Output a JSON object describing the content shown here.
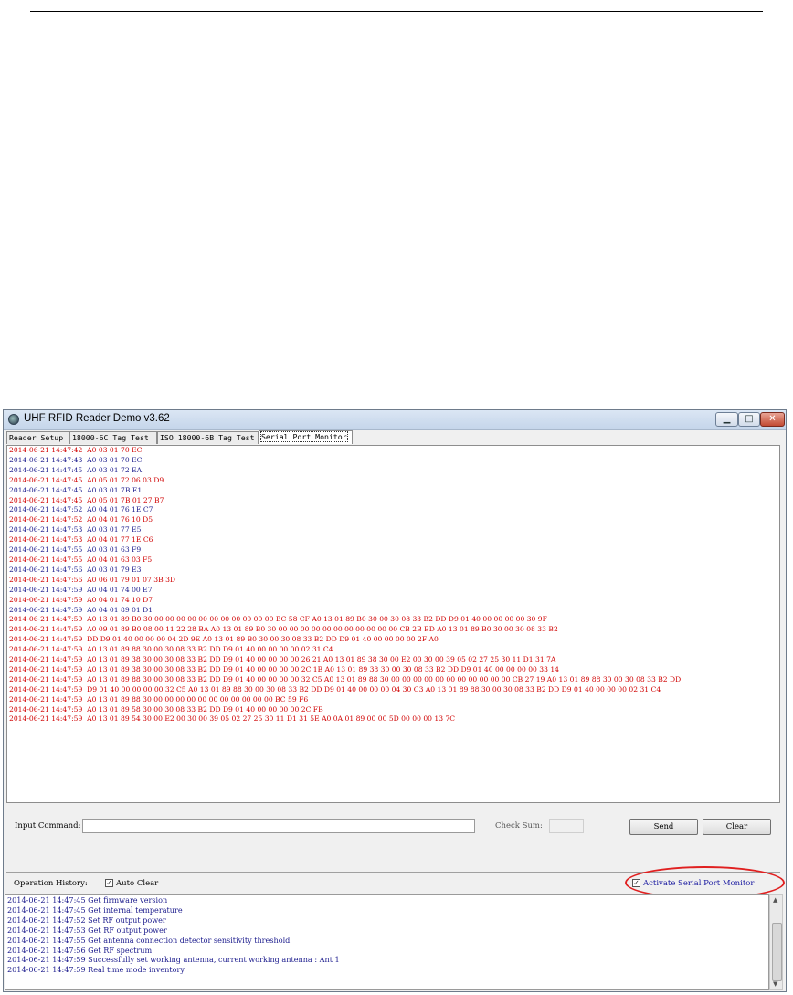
{
  "window": {
    "title": "UHF RFID Reader Demo v3.62"
  },
  "tabs": [
    {
      "label": "Reader Setup"
    },
    {
      "label": "18000-6C Tag Test"
    },
    {
      "label": "ISO 18000-6B Tag Test"
    },
    {
      "label": "Serial Port Monitor"
    }
  ],
  "monitor_lines": [
    {
      "text": "2014-06-21 14:47:42  A0 03 01 70 EC",
      "color": "#d00000"
    },
    {
      "text": "2014-06-21 14:47:43  A0 03 01 70 EC",
      "color": "#1a1a8c"
    },
    {
      "text": "2014-06-21 14:47:45  A0 03 01 72 EA",
      "color": "#1a1a8c"
    },
    {
      "text": "2014-06-21 14:47:45  A0 05 01 72 06 03 D9",
      "color": "#d00000"
    },
    {
      "text": "2014-06-21 14:47:45  A0 03 01 7B E1",
      "color": "#1a1a8c"
    },
    {
      "text": "2014-06-21 14:47:45  A0 05 01 7B 01 27 B7",
      "color": "#d00000"
    },
    {
      "text": "2014-06-21 14:47:52  A0 04 01 76 1E C7",
      "color": "#1a1a8c"
    },
    {
      "text": "2014-06-21 14:47:52  A0 04 01 76 10 D5",
      "color": "#d00000"
    },
    {
      "text": "2014-06-21 14:47:53  A0 03 01 77 E5",
      "color": "#1a1a8c"
    },
    {
      "text": "2014-06-21 14:47:53  A0 04 01 77 1E C6",
      "color": "#d00000"
    },
    {
      "text": "2014-06-21 14:47:55  A0 03 01 63 F9",
      "color": "#1a1a8c"
    },
    {
      "text": "2014-06-21 14:47:55  A0 04 01 63 03 F5",
      "color": "#d00000"
    },
    {
      "text": "2014-06-21 14:47:56  A0 03 01 79 E3",
      "color": "#1a1a8c"
    },
    {
      "text": "2014-06-21 14:47:56  A0 06 01 79 01 07 3B 3D",
      "color": "#d00000"
    },
    {
      "text": "2014-06-21 14:47:59  A0 04 01 74 00 E7",
      "color": "#1a1a8c"
    },
    {
      "text": "2014-06-21 14:47:59  A0 04 01 74 10 D7",
      "color": "#d00000"
    },
    {
      "text": "2014-06-21 14:47:59  A0 04 01 89 01 D1",
      "color": "#1a1a8c"
    },
    {
      "text": "2014-06-21 14:47:59  A0 13 01 89 B0 30 00 00 00 00 00 00 00 00 00 00 00 BC 58 CF A0 13 01 89 B0 30 00 30 08 33 B2 DD D9 01 40 00 00 00 00 30 9F",
      "color": "#d00000"
    },
    {
      "text": "2014-06-21 14:47:59  A0 09 01 89 B0 08 00 11 22 28 BA A0 13 01 89 B0 30 00 00 00 00 00 00 00 00 00 00 00 CB 2B BD A0 13 01 89 B0 30 00 30 08 33 B2",
      "color": "#d00000"
    },
    {
      "text": "2014-06-21 14:47:59  DD D9 01 40 00 00 00 04 2D 9E A0 13 01 89 B0 30 00 30 08 33 B2 DD D9 01 40 00 00 00 00 2F A0",
      "color": "#d00000"
    },
    {
      "text": "2014-06-21 14:47:59  A0 13 01 89 88 30 00 30 08 33 B2 DD D9 01 40 00 00 00 00 02 31 C4",
      "color": "#d00000"
    },
    {
      "text": "2014-06-21 14:47:59  A0 13 01 89 38 30 00 30 08 33 B2 DD D9 01 40 00 00 00 00 26 21 A0 13 01 89 38 30 00 E2 00 30 00 39 05 02 27 25 30 11 D1 31 7A",
      "color": "#d00000"
    },
    {
      "text": "2014-06-21 14:47:59  A0 13 01 89 38 30 00 30 08 33 B2 DD D9 01 40 00 00 00 00 2C 1B A0 13 01 89 38 30 00 30 08 33 B2 DD D9 01 40 00 00 00 00 33 14",
      "color": "#d00000"
    },
    {
      "text": "2014-06-21 14:47:59  A0 13 01 89 88 30 00 30 08 33 B2 DD D9 01 40 00 00 00 00 32 C5 A0 13 01 89 88 30 00 00 00 00 00 00 00 00 00 00 00 CB 27 19 A0 13 01 89 88 30 00 30 08 33 B2 DD",
      "color": "#d00000"
    },
    {
      "text": "2014-06-21 14:47:59  D9 01 40 00 00 00 00 32 C5 A0 13 01 89 88 30 00 30 08 33 B2 DD D9 01 40 00 00 00 04 30 C3 A0 13 01 89 88 30 00 30 08 33 B2 DD D9 01 40 00 00 00 02 31 C4",
      "color": "#d00000"
    },
    {
      "text": "2014-06-21 14:47:59  A0 13 01 89 88 30 00 00 00 00 00 00 00 00 00 00 00 BC 59 F6",
      "color": "#d00000"
    },
    {
      "text": "2014-06-21 14:47:59  A0 13 01 89 58 30 00 30 08 33 B2 DD D9 01 40 00 00 00 00 2C FB",
      "color": "#d00000"
    },
    {
      "text": "2014-06-21 14:47:59  A0 13 01 89 54 30 00 E2 00 30 00 39 05 02 27 25 30 11 D1 31 5E A0 0A 01 89 00 00 5D 00 00 00 13 7C",
      "color": "#d00000"
    }
  ],
  "command": {
    "input_label": "Input Command:",
    "input_value": "",
    "checksum_label": "Check Sum:",
    "checksum_value": "",
    "send_label": "Send",
    "clear_label": "Clear"
  },
  "history_bar": {
    "label": "Operation History:",
    "auto_clear_label": "Auto Clear",
    "auto_clear_checked": true,
    "monitor_label": "Activate Serial Port Monitor",
    "monitor_checked": true
  },
  "history_lines": [
    "2014-06-21 14:47:45 Get firmware version",
    "2014-06-21 14:47:45 Get internal temperature",
    "2014-06-21 14:47:52 Set RF output power",
    "2014-06-21 14:47:53 Get RF output power",
    "2014-06-21 14:47:55 Get antenna connection detector sensitivity threshold",
    "2014-06-21 14:47:56 Get RF spectrum",
    "2014-06-21 14:47:59 Successfully set working antenna, current working antenna : Ant 1",
    "2014-06-21 14:47:59 Real time mode inventory"
  ],
  "colors": {
    "received": "#d00000",
    "sent": "#1a1a8c",
    "highlight": "#e02020"
  }
}
